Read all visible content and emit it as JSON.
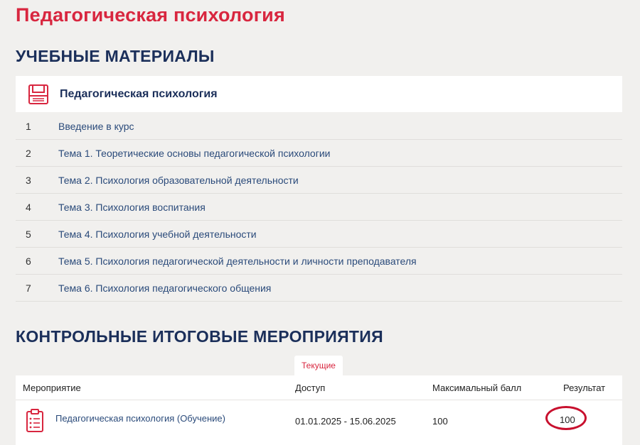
{
  "page": {
    "title": "Педагогическая психология"
  },
  "materials": {
    "section_title": "УЧЕБНЫЕ МАТЕРИАЛЫ",
    "course_title": "Педагогическая психология",
    "course_icon": "book-icon",
    "items": [
      {
        "num": "1",
        "label": "Введение в курс"
      },
      {
        "num": "2",
        "label": "Тема 1. Теоретические основы педагогической психологии"
      },
      {
        "num": "3",
        "label": "Тема 2. Психология образовательной деятельности"
      },
      {
        "num": "4",
        "label": "Тема 3. Психология воспитания"
      },
      {
        "num": "5",
        "label": "Тема 4. Психология учебной деятельности"
      },
      {
        "num": "6",
        "label": "Тема 5. Психология педагогической деятельности и личности преподавателя"
      },
      {
        "num": "7",
        "label": "Тема 6. Психология педагогического общения"
      }
    ]
  },
  "events": {
    "section_title": "КОНТРОЛЬНЫЕ ИТОГОВЫЕ МЕРОПРИЯТИЯ",
    "tab_current": "Текущие",
    "headers": {
      "event": "Мероприятие",
      "access": "Доступ",
      "max_score": "Максимальный балл",
      "result": "Результат"
    },
    "rows": [
      {
        "icon": "clipboard-icon",
        "event": "Педагогическая психология (Обучение)",
        "access": "01.01.2025 - 15.06.2025",
        "max_score": "100",
        "result": "100"
      }
    ]
  },
  "colors": {
    "accent": "#d8263f",
    "heading": "#1b2f5a",
    "link": "#2a4a7a",
    "circle": "#c8102e"
  }
}
